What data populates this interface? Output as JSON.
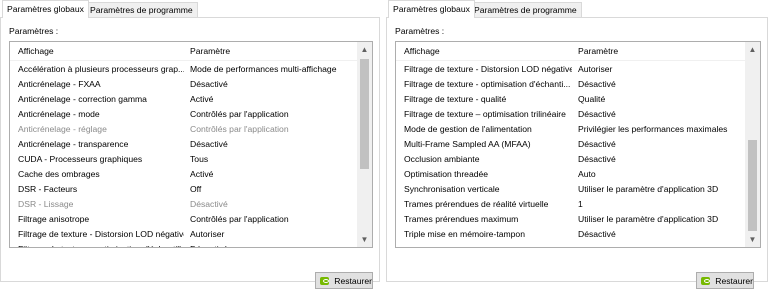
{
  "tabs": {
    "global": "Paramètres globaux",
    "program": "Paramètres de programme"
  },
  "params_label": "Paramètres :",
  "columns": {
    "feature": "Affichage",
    "setting": "Paramètre"
  },
  "restore_label": "Restaurer",
  "left_scroll_fraction": 0.0,
  "right_scroll_fraction": 1.0,
  "left_rows": [
    {
      "f": "Accélération à plusieurs processeurs grap...",
      "s": "Mode de performances multi-affichage",
      "disabled": false
    },
    {
      "f": "Anticrénelage - FXAA",
      "s": "Désactivé",
      "disabled": false
    },
    {
      "f": "Anticrénelage - correction gamma",
      "s": "Activé",
      "disabled": false
    },
    {
      "f": "Anticrénelage - mode",
      "s": "Contrôlés par l'application",
      "disabled": false
    },
    {
      "f": "Anticrénelage - réglage",
      "s": "Contrôlés par l'application",
      "disabled": true
    },
    {
      "f": "Anticrénelage - transparence",
      "s": "Désactivé",
      "disabled": false
    },
    {
      "f": "CUDA - Processeurs graphiques",
      "s": "Tous",
      "disabled": false
    },
    {
      "f": "Cache des ombrages",
      "s": "Activé",
      "disabled": false
    },
    {
      "f": "DSR - Facteurs",
      "s": "Off",
      "disabled": false
    },
    {
      "f": "DSR - Lissage",
      "s": "Désactivé",
      "disabled": true
    },
    {
      "f": "Filtrage anisotrope",
      "s": "Contrôlés par l'application",
      "disabled": false
    },
    {
      "f": "Filtrage de texture - Distorsion LOD négative",
      "s": "Autoriser",
      "disabled": false
    },
    {
      "f": "Filtrage de texture - optimisation d'échantillonnage",
      "s": "Désactivé",
      "disabled": false
    }
  ],
  "right_rows": [
    {
      "f": "Filtrage de texture - Distorsion LOD négative",
      "s": "Autoriser",
      "disabled": false
    },
    {
      "f": "Filtrage de texture - optimisation d'échanti...",
      "s": "Désactivé",
      "disabled": false
    },
    {
      "f": "Filtrage de texture - qualité",
      "s": "Qualité",
      "disabled": false
    },
    {
      "f": "Filtrage de texture – optimisation trilinéaire",
      "s": "Désactivé",
      "disabled": false
    },
    {
      "f": "Mode de gestion de l'alimentation",
      "s": "Privilégier les performances maximales",
      "disabled": false
    },
    {
      "f": "Multi-Frame Sampled AA (MFAA)",
      "s": "Désactivé",
      "disabled": false
    },
    {
      "f": "Occlusion ambiante",
      "s": "Désactivé",
      "disabled": false
    },
    {
      "f": "Optimisation threadée",
      "s": "Auto",
      "disabled": false
    },
    {
      "f": "Synchronisation verticale",
      "s": "Utiliser le paramètre d'application 3D",
      "disabled": false
    },
    {
      "f": "Trames prérendues de réalité virtuelle",
      "s": "1",
      "disabled": false
    },
    {
      "f": "Trames prérendues maximum",
      "s": "Utiliser le paramètre d'application 3D",
      "disabled": false
    },
    {
      "f": "Triple mise en mémoire-tampon",
      "s": "Désactivé",
      "disabled": false
    }
  ]
}
